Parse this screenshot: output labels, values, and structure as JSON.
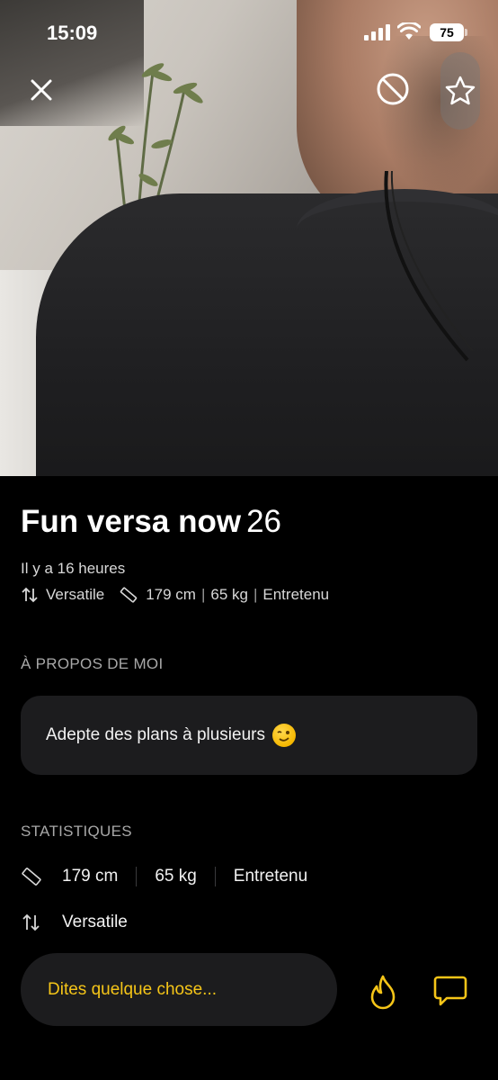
{
  "status_bar": {
    "time": "15:09",
    "battery": "75"
  },
  "profile": {
    "name": "Fun versa now",
    "age": "26",
    "last_seen": "Il y a 16 heures",
    "position": "Versatile",
    "height": "179 cm",
    "weight": "65 kg",
    "body_type": "Entretenu"
  },
  "about": {
    "title": "À PROPOS DE MOI",
    "text": "Adepte des plans à plusieurs"
  },
  "stats": {
    "title": "STATISTIQUES",
    "height": "179 cm",
    "weight": "65 kg",
    "body_type": "Entretenu",
    "position": "Versatile"
  },
  "chat": {
    "placeholder": "Dites quelque chose..."
  },
  "icons": {
    "close": "close-icon",
    "block": "block-icon",
    "favorite": "star-icon",
    "position": "arrows-updown-icon",
    "measure": "ruler-icon",
    "tap": "flame-icon",
    "message": "chat-bubble-icon"
  },
  "colors": {
    "accent": "#f5c518",
    "background": "#000000",
    "card": "#1c1c1e"
  }
}
